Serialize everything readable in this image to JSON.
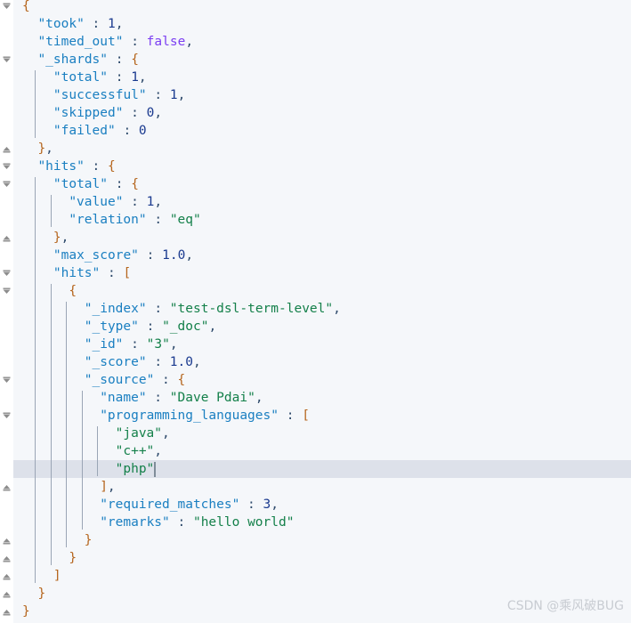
{
  "editor": {
    "background_color": "#f5f7fa",
    "gutter_color": "#ffffff",
    "current_line_color": "#dde1ea",
    "line_height": 20,
    "font_size": 14.5,
    "colors": {
      "key": "#1a7fc1",
      "string": "#14804a",
      "number": "#1a3a8f",
      "boolean": "#7b3ff2",
      "punctuation": "#2e4a6b",
      "bracket": "#b5651d",
      "indent_guide": "#9aa5b5",
      "caret": "#7f8c99",
      "watermark": "#c8ccd2"
    }
  },
  "document": {
    "language": "json",
    "current_line_number": 27,
    "caret_line_number": 27,
    "lines": [
      {
        "n": 1,
        "indent": 0,
        "text": "{",
        "tokens": [
          {
            "t": "{",
            "c": "br"
          }
        ]
      },
      {
        "n": 2,
        "indent": 1,
        "text": "\"took\" : 1,",
        "tokens": [
          {
            "t": "\"took\"",
            "c": "k"
          },
          {
            "t": " : ",
            "c": "p"
          },
          {
            "t": "1",
            "c": "n"
          },
          {
            "t": ",",
            "c": "p"
          }
        ]
      },
      {
        "n": 3,
        "indent": 1,
        "text": "\"timed_out\" : false,",
        "tokens": [
          {
            "t": "\"timed_out\"",
            "c": "k"
          },
          {
            "t": " : ",
            "c": "p"
          },
          {
            "t": "false",
            "c": "b"
          },
          {
            "t": ",",
            "c": "p"
          }
        ]
      },
      {
        "n": 4,
        "indent": 1,
        "text": "\"_shards\" : {",
        "tokens": [
          {
            "t": "\"_shards\"",
            "c": "k"
          },
          {
            "t": " : ",
            "c": "p"
          },
          {
            "t": "{",
            "c": "br"
          }
        ]
      },
      {
        "n": 5,
        "indent": 2,
        "text": "\"total\" : 1,",
        "tokens": [
          {
            "t": "\"total\"",
            "c": "k"
          },
          {
            "t": " : ",
            "c": "p"
          },
          {
            "t": "1",
            "c": "n"
          },
          {
            "t": ",",
            "c": "p"
          }
        ]
      },
      {
        "n": 6,
        "indent": 2,
        "text": "\"successful\" : 1,",
        "tokens": [
          {
            "t": "\"successful\"",
            "c": "k"
          },
          {
            "t": " : ",
            "c": "p"
          },
          {
            "t": "1",
            "c": "n"
          },
          {
            "t": ",",
            "c": "p"
          }
        ]
      },
      {
        "n": 7,
        "indent": 2,
        "text": "\"skipped\" : 0,",
        "tokens": [
          {
            "t": "\"skipped\"",
            "c": "k"
          },
          {
            "t": " : ",
            "c": "p"
          },
          {
            "t": "0",
            "c": "n"
          },
          {
            "t": ",",
            "c": "p"
          }
        ]
      },
      {
        "n": 8,
        "indent": 2,
        "text": "\"failed\" : 0",
        "tokens": [
          {
            "t": "\"failed\"",
            "c": "k"
          },
          {
            "t": " : ",
            "c": "p"
          },
          {
            "t": "0",
            "c": "n"
          }
        ]
      },
      {
        "n": 9,
        "indent": 1,
        "text": "},",
        "tokens": [
          {
            "t": "}",
            "c": "br"
          },
          {
            "t": ",",
            "c": "p"
          }
        ]
      },
      {
        "n": 10,
        "indent": 1,
        "text": "\"hits\" : {",
        "tokens": [
          {
            "t": "\"hits\"",
            "c": "k"
          },
          {
            "t": " : ",
            "c": "p"
          },
          {
            "t": "{",
            "c": "br"
          }
        ]
      },
      {
        "n": 11,
        "indent": 2,
        "text": "\"total\" : {",
        "tokens": [
          {
            "t": "\"total\"",
            "c": "k"
          },
          {
            "t": " : ",
            "c": "p"
          },
          {
            "t": "{",
            "c": "br"
          }
        ]
      },
      {
        "n": 12,
        "indent": 3,
        "text": "\"value\" : 1,",
        "tokens": [
          {
            "t": "\"value\"",
            "c": "k"
          },
          {
            "t": " : ",
            "c": "p"
          },
          {
            "t": "1",
            "c": "n"
          },
          {
            "t": ",",
            "c": "p"
          }
        ]
      },
      {
        "n": 13,
        "indent": 3,
        "text": "\"relation\" : \"eq\"",
        "tokens": [
          {
            "t": "\"relation\"",
            "c": "k"
          },
          {
            "t": " : ",
            "c": "p"
          },
          {
            "t": "\"eq\"",
            "c": "s"
          }
        ]
      },
      {
        "n": 14,
        "indent": 2,
        "text": "},",
        "tokens": [
          {
            "t": "}",
            "c": "br"
          },
          {
            "t": ",",
            "c": "p"
          }
        ]
      },
      {
        "n": 15,
        "indent": 2,
        "text": "\"max_score\" : 1.0,",
        "tokens": [
          {
            "t": "\"max_score\"",
            "c": "k"
          },
          {
            "t": " : ",
            "c": "p"
          },
          {
            "t": "1.0",
            "c": "n"
          },
          {
            "t": ",",
            "c": "p"
          }
        ]
      },
      {
        "n": 16,
        "indent": 2,
        "text": "\"hits\" : [",
        "tokens": [
          {
            "t": "\"hits\"",
            "c": "k"
          },
          {
            "t": " : ",
            "c": "p"
          },
          {
            "t": "[",
            "c": "br"
          }
        ]
      },
      {
        "n": 17,
        "indent": 3,
        "text": "{",
        "tokens": [
          {
            "t": "{",
            "c": "br"
          }
        ]
      },
      {
        "n": 18,
        "indent": 4,
        "text": "\"_index\" : \"test-dsl-term-level\",",
        "tokens": [
          {
            "t": "\"_index\"",
            "c": "k"
          },
          {
            "t": " : ",
            "c": "p"
          },
          {
            "t": "\"test-dsl-term-level\"",
            "c": "s"
          },
          {
            "t": ",",
            "c": "p"
          }
        ]
      },
      {
        "n": 19,
        "indent": 4,
        "text": "\"_type\" : \"_doc\",",
        "tokens": [
          {
            "t": "\"_type\"",
            "c": "k"
          },
          {
            "t": " : ",
            "c": "p"
          },
          {
            "t": "\"_doc\"",
            "c": "s"
          },
          {
            "t": ",",
            "c": "p"
          }
        ]
      },
      {
        "n": 20,
        "indent": 4,
        "text": "\"_id\" : \"3\",",
        "tokens": [
          {
            "t": "\"_id\"",
            "c": "k"
          },
          {
            "t": " : ",
            "c": "p"
          },
          {
            "t": "\"3\"",
            "c": "s"
          },
          {
            "t": ",",
            "c": "p"
          }
        ]
      },
      {
        "n": 21,
        "indent": 4,
        "text": "\"_score\" : 1.0,",
        "tokens": [
          {
            "t": "\"_score\"",
            "c": "k"
          },
          {
            "t": " : ",
            "c": "p"
          },
          {
            "t": "1.0",
            "c": "n"
          },
          {
            "t": ",",
            "c": "p"
          }
        ]
      },
      {
        "n": 22,
        "indent": 4,
        "text": "\"_source\" : {",
        "tokens": [
          {
            "t": "\"_source\"",
            "c": "k"
          },
          {
            "t": " : ",
            "c": "p"
          },
          {
            "t": "{",
            "c": "br"
          }
        ]
      },
      {
        "n": 23,
        "indent": 5,
        "text": "\"name\" : \"Dave Pdai\",",
        "tokens": [
          {
            "t": "\"name\"",
            "c": "k"
          },
          {
            "t": " : ",
            "c": "p"
          },
          {
            "t": "\"Dave Pdai\"",
            "c": "s"
          },
          {
            "t": ",",
            "c": "p"
          }
        ]
      },
      {
        "n": 24,
        "indent": 5,
        "text": "\"programming_languages\" : [",
        "tokens": [
          {
            "t": "\"programming_languages\"",
            "c": "k"
          },
          {
            "t": " : ",
            "c": "p"
          },
          {
            "t": "[",
            "c": "br"
          }
        ]
      },
      {
        "n": 25,
        "indent": 6,
        "text": "\"java\",",
        "tokens": [
          {
            "t": "\"java\"",
            "c": "s"
          },
          {
            "t": ",",
            "c": "p"
          }
        ]
      },
      {
        "n": 26,
        "indent": 6,
        "text": "\"c++\",",
        "tokens": [
          {
            "t": "\"c++\"",
            "c": "s"
          },
          {
            "t": ",",
            "c": "p"
          }
        ]
      },
      {
        "n": 27,
        "indent": 6,
        "text": "\"php\"",
        "tokens": [
          {
            "t": "\"php\"",
            "c": "s"
          }
        ]
      },
      {
        "n": 28,
        "indent": 5,
        "text": "],",
        "tokens": [
          {
            "t": "]",
            "c": "br"
          },
          {
            "t": ",",
            "c": "p"
          }
        ]
      },
      {
        "n": 29,
        "indent": 5,
        "text": "\"required_matches\" : 3,",
        "tokens": [
          {
            "t": "\"required_matches\"",
            "c": "k"
          },
          {
            "t": " : ",
            "c": "p"
          },
          {
            "t": "3",
            "c": "n"
          },
          {
            "t": ",",
            "c": "p"
          }
        ]
      },
      {
        "n": 30,
        "indent": 5,
        "text": "\"remarks\" : \"hello world\"",
        "tokens": [
          {
            "t": "\"remarks\"",
            "c": "k"
          },
          {
            "t": " : ",
            "c": "p"
          },
          {
            "t": "\"hello world\"",
            "c": "s"
          }
        ]
      },
      {
        "n": 31,
        "indent": 4,
        "text": "}",
        "tokens": [
          {
            "t": "}",
            "c": "br"
          }
        ]
      },
      {
        "n": 32,
        "indent": 3,
        "text": "}",
        "tokens": [
          {
            "t": "}",
            "c": "br"
          }
        ]
      },
      {
        "n": 33,
        "indent": 2,
        "text": "]",
        "tokens": [
          {
            "t": "]",
            "c": "br"
          }
        ]
      },
      {
        "n": 34,
        "indent": 1,
        "text": "}",
        "tokens": [
          {
            "t": "}",
            "c": "br"
          }
        ]
      },
      {
        "n": 35,
        "indent": 0,
        "text": "}",
        "tokens": [
          {
            "t": "}",
            "c": "br"
          }
        ]
      }
    ]
  },
  "fold_markers": [
    {
      "line": 1,
      "state": "expanded",
      "glyph": "chevron-down"
    },
    {
      "line": 4,
      "state": "expanded",
      "glyph": "chevron-down"
    },
    {
      "line": 9,
      "state": "end",
      "glyph": "chevron-up"
    },
    {
      "line": 10,
      "state": "expanded",
      "glyph": "chevron-down"
    },
    {
      "line": 11,
      "state": "expanded",
      "glyph": "chevron-down"
    },
    {
      "line": 14,
      "state": "end",
      "glyph": "chevron-up"
    },
    {
      "line": 16,
      "state": "expanded",
      "glyph": "chevron-down"
    },
    {
      "line": 17,
      "state": "expanded",
      "glyph": "chevron-down"
    },
    {
      "line": 22,
      "state": "expanded",
      "glyph": "chevron-down"
    },
    {
      "line": 24,
      "state": "expanded",
      "glyph": "chevron-down"
    },
    {
      "line": 28,
      "state": "end",
      "glyph": "chevron-up"
    },
    {
      "line": 31,
      "state": "end",
      "glyph": "chevron-up"
    },
    {
      "line": 32,
      "state": "end",
      "glyph": "chevron-up"
    },
    {
      "line": 33,
      "state": "end",
      "glyph": "chevron-up"
    },
    {
      "line": 34,
      "state": "end",
      "glyph": "chevron-up"
    },
    {
      "line": 35,
      "state": "end",
      "glyph": "chevron-up"
    }
  ],
  "indent_guides": [
    {
      "level": 1,
      "from_line": 5,
      "to_line": 8
    },
    {
      "level": 1,
      "from_line": 11,
      "to_line": 33
    },
    {
      "level": 2,
      "from_line": 12,
      "to_line": 13
    },
    {
      "level": 2,
      "from_line": 17,
      "to_line": 32
    },
    {
      "level": 3,
      "from_line": 18,
      "to_line": 31
    },
    {
      "level": 4,
      "from_line": 23,
      "to_line": 30
    },
    {
      "level": 5,
      "from_line": 25,
      "to_line": 27
    }
  ],
  "watermark": {
    "text": "CSDN @乘风破BUG"
  }
}
